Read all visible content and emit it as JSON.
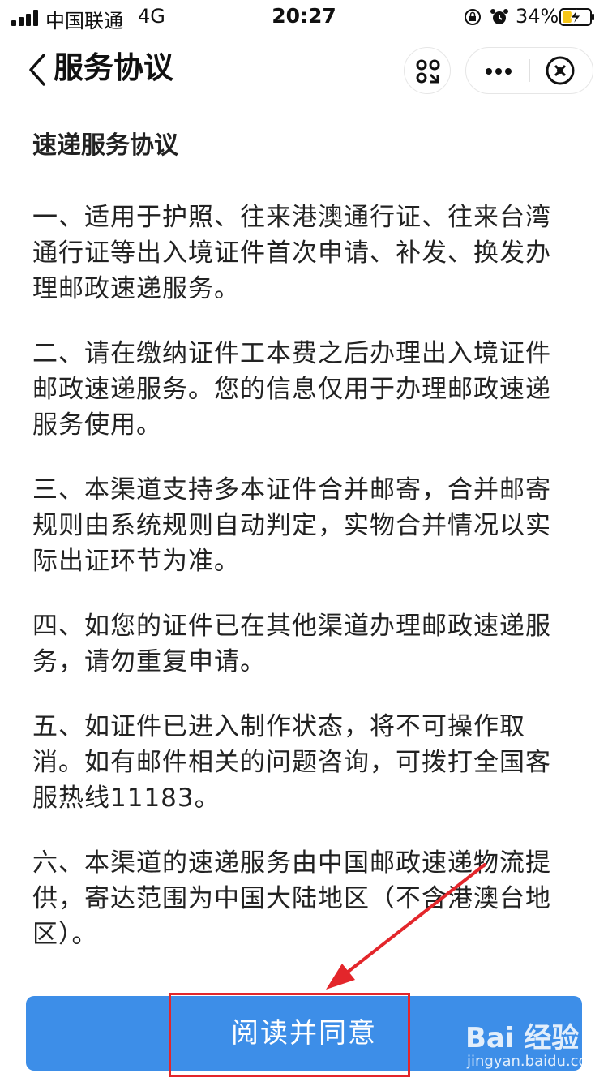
{
  "status_bar": {
    "carrier": "中国联通",
    "network": "4G",
    "time": "20:27",
    "battery_percent": "34%",
    "battery_level": 0.34,
    "icons": [
      "signal-icon",
      "lock-rotation-icon",
      "alarm-icon",
      "battery-charging-icon"
    ]
  },
  "nav": {
    "title": "服务协议",
    "icons": [
      "back-icon",
      "scan-icon",
      "more-icon",
      "close-icon"
    ]
  },
  "document": {
    "title": "速递服务协议",
    "clauses": [
      "一、适用于护照、往来港澳通行证、往来台湾通行证等出入境证件首次申请、补发、换发办理邮政速递服务。",
      "二、请在缴纳证件工本费之后办理出入境证件邮政速递服务。您的信息仅用于办理邮政速递服务使用。",
      "三、本渠道支持多本证件合并邮寄，合并邮寄规则由系统规则自动判定，实物合并情况以实际出证环节为准。",
      "四、如您的证件已在其他渠道办理邮政速递服务，请勿重复申请。",
      "五、如证件已进入制作状态，将不可操作取消。如有邮件相关的问题咨询，可拨打全国客服热线11183。",
      "六、本渠道的速递服务由中国邮政速递物流提供，寄达范围为中国大陆地区（不含港澳台地区）。"
    ]
  },
  "footer": {
    "agree_label": "阅读并同意",
    "accent_color": "#3d8ee8"
  },
  "annotation": {
    "color": "#e3262b"
  },
  "watermark": {
    "logo": "Bai 经验",
    "url": "jingyan.baidu.com"
  }
}
